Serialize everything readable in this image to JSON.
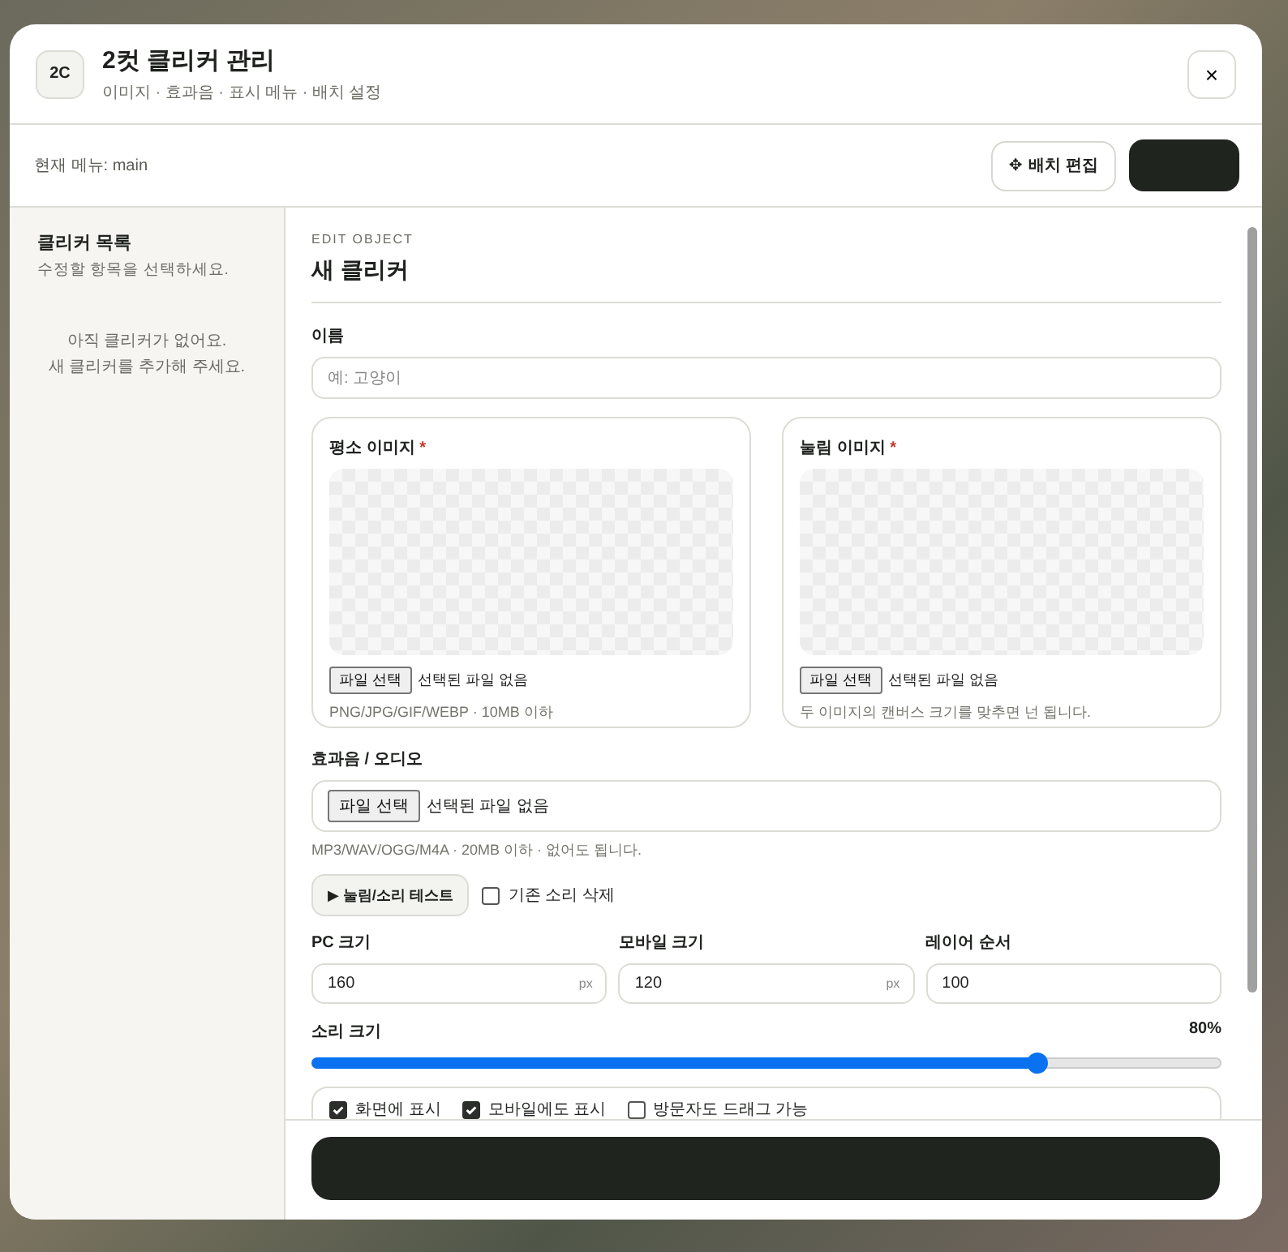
{
  "header": {
    "logo": "2C",
    "title": "2컷 클리커 관리",
    "subtitle": "이미지 · 효과음 · 표시 메뉴 · 배치 설정",
    "close": "×"
  },
  "toolbar": {
    "current_menu": "현재 메뉴: main",
    "layout_button": {
      "icon": "✥",
      "label": "배치 편집"
    }
  },
  "sidebar": {
    "title": "클리커 목록",
    "subtitle": "수정할 항목을 선택하세요.",
    "empty_message": "아직 클리커가 없어요.\n새 클리커를 추가해 주세요."
  },
  "editor": {
    "eyebrow": "EDIT OBJECT",
    "title": "새 클리커",
    "name_field": {
      "label": "이름",
      "placeholder": "예: 고양이"
    },
    "images": [
      {
        "label": "평소 이미지",
        "required_mark": "*",
        "button": "파일 선택",
        "file_status": "선택된 파일 없음",
        "hint": "PNG/JPG/GIF/WEBP · 10MB 이하"
      },
      {
        "label": "눌림 이미지",
        "required_mark": "*",
        "button": "파일 선택",
        "file_status": "선택된 파일 없음",
        "hint": "두 이미지의 캔버스 크기를 맞추면 넌 됩니다."
      }
    ],
    "audio": {
      "label": "효과음 / 오디오",
      "button": "파일 선택",
      "file_status": "선택된 파일 없음",
      "hint": "MP3/WAV/OGG/M4A · 20MB 이하 · 없어도 됩니다."
    },
    "test_button": {
      "icon": "▶",
      "label": "눌림/소리 테스트"
    },
    "delete_sound": {
      "label": "기존 소리 삭제",
      "checked": false
    },
    "sizes": [
      {
        "label": "PC 크기",
        "value": "160",
        "unit": "px"
      },
      {
        "label": "모바일 크기",
        "value": "120",
        "unit": "px"
      },
      {
        "label": "레이어 순서",
        "value": "100"
      }
    ],
    "volume": {
      "label": "소리 크기",
      "reading": "80%",
      "level": 0.8
    },
    "options": [
      {
        "label": "화면에 표시",
        "checked": true
      },
      {
        "label": "모바일에도 표시",
        "checked": true
      },
      {
        "label": "방문자도 드래그 가능",
        "checked": false
      }
    ]
  }
}
